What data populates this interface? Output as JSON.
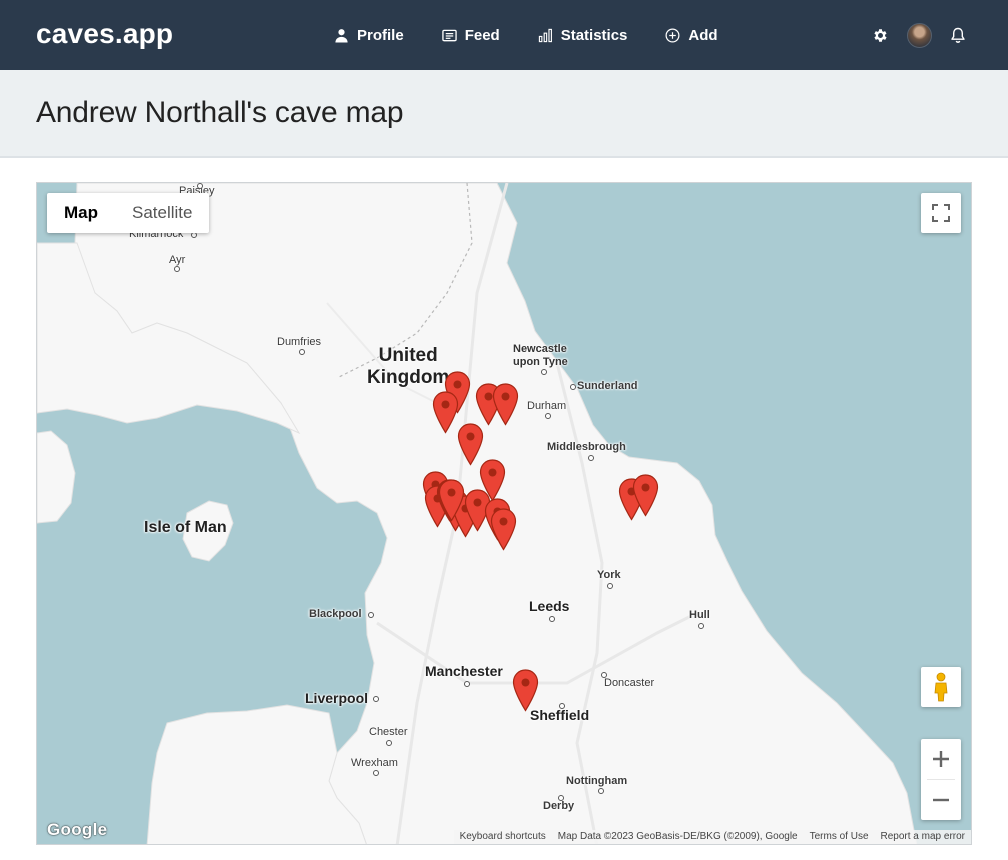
{
  "app": {
    "brand": "caves.app",
    "nav": [
      {
        "label": "Profile",
        "icon": "user-icon"
      },
      {
        "label": "Feed",
        "icon": "feed-icon"
      },
      {
        "label": "Statistics",
        "icon": "statistics-icon"
      },
      {
        "label": "Add",
        "icon": "add-circle-icon"
      }
    ],
    "right_icons": [
      "gear-icon",
      "avatar",
      "bell-icon"
    ]
  },
  "page": {
    "title": "Andrew Northall's cave map"
  },
  "map": {
    "map_type": {
      "map_label": "Map",
      "satellite_label": "Satellite",
      "selected": "Map"
    },
    "controls": {
      "fullscreen": "fullscreen-icon",
      "pegman": "pegman-icon",
      "zoom_in": "+",
      "zoom_out": "−"
    },
    "google_logo": "Google",
    "attribution": {
      "shortcuts": "Keyboard shortcuts",
      "data": "Map Data ©2023 GeoBasis-DE/BKG (©2009), Google",
      "terms": "Terms of Use",
      "report": "Report a map error"
    },
    "colors": {
      "water": "#aacbd2",
      "land": "#f7f7f7",
      "marker": "#ea4335",
      "marker_dark": "#a52714"
    },
    "labels": {
      "paisley": "Paisley",
      "kilmarnock": "Kilmarnock",
      "ayr": "Ayr",
      "dumfries": "Dumfries",
      "country_line1": "United",
      "country_line2": "Kingdom",
      "newcastle_line1": "Newcastle",
      "newcastle_line2": "upon Tyne",
      "sunderland": "Sunderland",
      "durham": "Durham",
      "middlesbrough": "Middlesbrough",
      "isle_of_man": "Isle of Man",
      "york": "York",
      "leeds": "Leeds",
      "blackpool": "Blackpool",
      "hull": "Hull",
      "manchester": "Manchester",
      "doncaster": "Doncaster",
      "liverpool": "Liverpool",
      "sheffield": "Sheffield",
      "chester": "Chester",
      "wrexham": "Wrexham",
      "nottingham": "Nottingham",
      "derby": "Derby"
    },
    "marker_count": 19
  }
}
